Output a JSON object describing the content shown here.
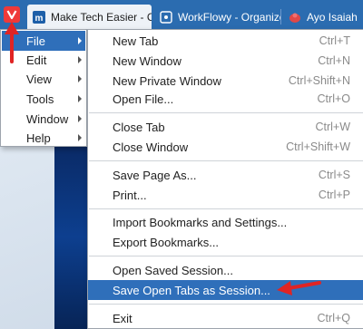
{
  "tabs": [
    {
      "title": "Make Tech Easier - Compu",
      "favicon": "mte-icon",
      "active": true
    },
    {
      "title": "WorkFlowy - Organize yo",
      "favicon": "workflowy-icon",
      "active": false
    },
    {
      "title": "Ayo Isaiah",
      "favicon": "profile-icon",
      "active": false
    }
  ],
  "main_menu": {
    "items": [
      {
        "label": "File",
        "underline": "F",
        "selected": true
      },
      {
        "label": "Edit",
        "underline": "E",
        "selected": false
      },
      {
        "label": "View",
        "underline": "V",
        "selected": false
      },
      {
        "label": "Tools",
        "underline": "T",
        "selected": false
      },
      {
        "label": "Window",
        "underline": "W",
        "selected": false
      },
      {
        "label": "Help",
        "underline": "H",
        "selected": false
      }
    ]
  },
  "file_menu": {
    "groups": [
      [
        {
          "label": "New Tab",
          "shortcut": "Ctrl+T"
        },
        {
          "label": "New Window",
          "shortcut": "Ctrl+N"
        },
        {
          "label": "New Private Window",
          "shortcut": "Ctrl+Shift+N"
        },
        {
          "label": "Open File...",
          "shortcut": "Ctrl+O"
        }
      ],
      [
        {
          "label": "Close Tab",
          "shortcut": "Ctrl+W"
        },
        {
          "label": "Close Window",
          "shortcut": "Ctrl+Shift+W"
        }
      ],
      [
        {
          "label": "Save Page As...",
          "shortcut": "Ctrl+S"
        },
        {
          "label": "Print...",
          "shortcut": "Ctrl+P"
        }
      ],
      [
        {
          "label": "Import Bookmarks and Settings...",
          "shortcut": ""
        },
        {
          "label": "Export Bookmarks...",
          "shortcut": ""
        }
      ],
      [
        {
          "label": "Open Saved Session...",
          "shortcut": ""
        },
        {
          "label": "Save Open Tabs as Session...",
          "shortcut": "",
          "selected": true
        }
      ],
      [
        {
          "label": "Exit",
          "shortcut": "Ctrl+Q"
        }
      ]
    ]
  },
  "colors": {
    "tabbar": "#2b6cb0",
    "highlight": "#2f6fba",
    "vivaldi_red": "#ef3939",
    "annotation_red": "#e02424"
  }
}
